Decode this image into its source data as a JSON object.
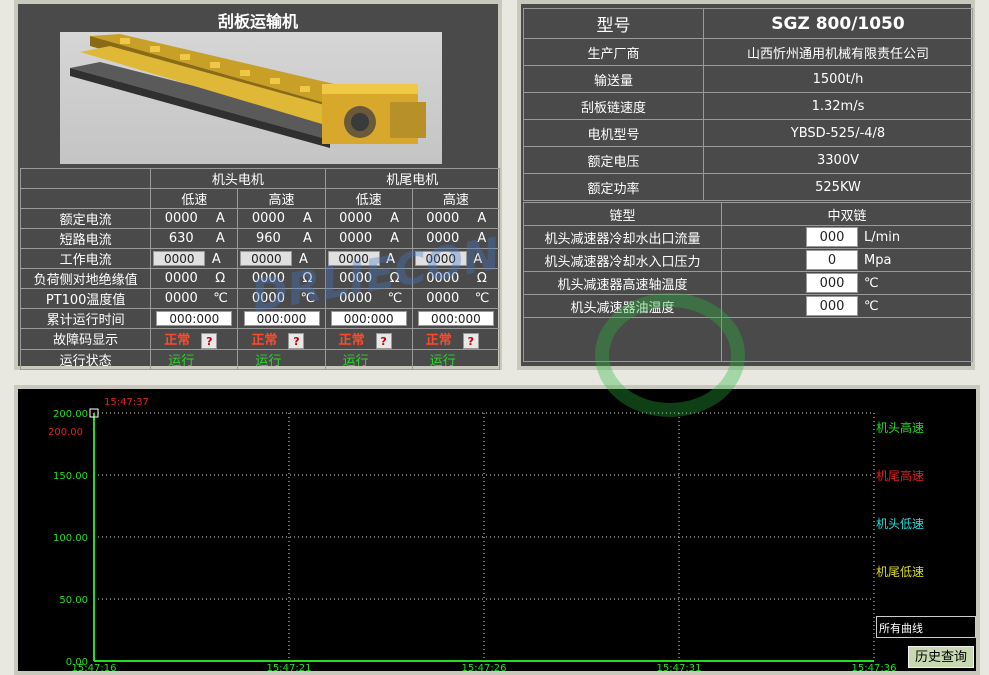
{
  "conveyor": {
    "title": "刮板运输机",
    "group_head": "机头电机",
    "group_tail": "机尾电机",
    "speed_low": "低速",
    "speed_high": "高速",
    "rows": [
      {
        "label": "额定电流",
        "values": [
          "0000",
          "0000",
          "0000",
          "0000"
        ],
        "unit": "A"
      },
      {
        "label": "短路电流",
        "values": [
          "630",
          "960",
          "0000",
          "0000"
        ],
        "unit": "A"
      },
      {
        "label": "工作电流",
        "values": [
          "0000",
          "0000",
          "0000",
          "0000"
        ],
        "unit": "A"
      },
      {
        "label": "负荷侧对地绝缘值",
        "values": [
          "0000",
          "0000",
          "0000",
          "0000"
        ],
        "unit": "Ω"
      },
      {
        "label": "PT100温度值",
        "values": [
          "0000",
          "0000",
          "0000",
          "0000"
        ],
        "unit": "℃"
      },
      {
        "label": "累计运行时间",
        "values": [
          "000:000",
          "000:000",
          "000:000",
          "000:000"
        ]
      },
      {
        "label": "故障码显示",
        "values": [
          "正常",
          "正常",
          "正常",
          "正常"
        ],
        "button": "?"
      },
      {
        "label": "运行状态",
        "values": [
          "运行",
          "运行",
          "运行",
          "运行"
        ]
      }
    ]
  },
  "spec": {
    "model_label": "型号",
    "model_value": "SGZ 800/1050",
    "rows": [
      {
        "k": "生产厂商",
        "v": "山西忻州通用机械有限责任公司"
      },
      {
        "k": "输送量",
        "v": "1500t/h"
      },
      {
        "k": "刮板链速度",
        "v": "1.32m/s"
      },
      {
        "k": "电机型号",
        "v": "YBSD-525/-4/8"
      },
      {
        "k": "额定电压",
        "v": "3300V"
      },
      {
        "k": "额定功率",
        "v": "525KW"
      }
    ],
    "chain_label": "链型",
    "chain_value": "中双链",
    "sensors": [
      {
        "k": "机头减速器冷却水出口流量",
        "v": "000",
        "unit": "L/min"
      },
      {
        "k": "机头减速器冷却水入口压力",
        "v": "0",
        "unit": "Mpa"
      },
      {
        "k": "机头减速器高速轴温度",
        "v": "000",
        "unit": "℃"
      },
      {
        "k": "机头减速器油温度",
        "v": "000",
        "unit": "℃"
      }
    ]
  },
  "chart_data": {
    "type": "line",
    "timestamp": "15:47:37",
    "y_ticks": [
      "200.00",
      "150.00",
      "100.00",
      "50.00",
      "0.00"
    ],
    "y_top_label": "200.00",
    "ylim": [
      0,
      200
    ],
    "x_ticks": [
      "15:47:16",
      "15:47:21",
      "15:47:26",
      "15:47:31",
      "15:47:36"
    ],
    "grid": true,
    "series": [
      {
        "name": "机头高速",
        "color": "#22dd22",
        "values": []
      },
      {
        "name": "机尾高速",
        "color": "#dd2222",
        "values": []
      },
      {
        "name": "机头低速",
        "color": "#22dddd",
        "values": []
      },
      {
        "name": "机尾低速",
        "color": "#dddd22",
        "values": []
      }
    ]
  },
  "controls": {
    "curve_select": "所有曲线",
    "history_button": "历史查询"
  },
  "watermark": "DRLIECON"
}
